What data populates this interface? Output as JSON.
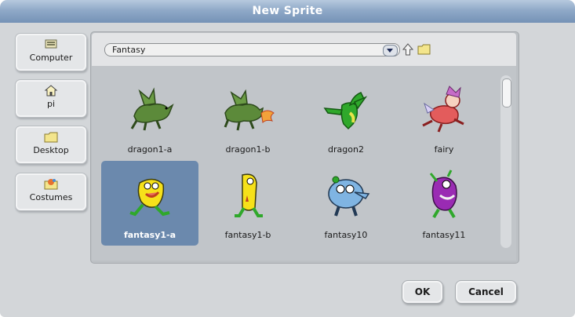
{
  "window": {
    "title": "New Sprite"
  },
  "sidebar": {
    "items": [
      {
        "label": "Computer",
        "icon": "computer-icon"
      },
      {
        "label": "pi",
        "icon": "home-icon"
      },
      {
        "label": "Desktop",
        "icon": "folder-icon"
      },
      {
        "label": "Costumes",
        "icon": "costumes-icon"
      }
    ]
  },
  "browser": {
    "current_folder": "Fantasy",
    "selected": "fantasy1-a",
    "items": [
      {
        "name": "dragon1-a"
      },
      {
        "name": "dragon1-b"
      },
      {
        "name": "dragon2"
      },
      {
        "name": "fairy"
      },
      {
        "name": "fantasy1-a"
      },
      {
        "name": "fantasy1-b"
      },
      {
        "name": "fantasy10"
      },
      {
        "name": "fantasy11"
      }
    ]
  },
  "buttons": {
    "ok": "OK",
    "cancel": "Cancel"
  },
  "colors": {
    "titlebar": "#8fa9c8",
    "selection": "#6b89ad",
    "dialog_bg": "#d3d6d9"
  }
}
